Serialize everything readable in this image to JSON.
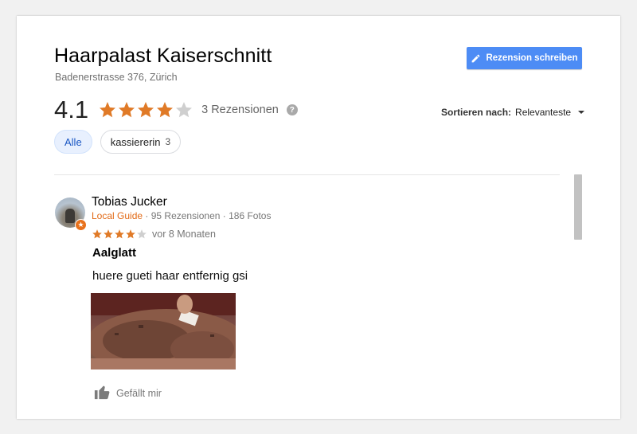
{
  "place": {
    "name": "Haarpalast Kaiserschnitt",
    "address": "Badenerstrasse 376, Zürich"
  },
  "write_review": {
    "label": "Rezension schreiben"
  },
  "summary": {
    "rating": "4.1",
    "rating_value": 4.1,
    "max_stars": 5,
    "count_text": "3 Rezensionen",
    "help_symbol": "?"
  },
  "sort": {
    "label": "Sortieren nach:",
    "value": "Relevanteste"
  },
  "filters": [
    {
      "label": "Alle",
      "count": ""
    },
    {
      "label": "kassiererin",
      "count": "3"
    }
  ],
  "colors": {
    "star_filled": "#e07a27",
    "star_empty": "#cfcfcf",
    "button_bg": "#4d8cf5",
    "local_guide": "#e26a16"
  },
  "review": {
    "author": "Tobias Jucker",
    "local_guide": "Local Guide",
    "stats": "· 95 Rezensionen · 186 Fotos",
    "stars": 4,
    "time": "vor 8 Monaten",
    "title": "Aalglatt",
    "text": "huere gueti haar entfernig gsi",
    "like_label": "Gefällt mir"
  },
  "icons": {
    "edit": "pencil-icon",
    "help": "help-icon",
    "caret": "caret-down-icon",
    "like": "thumbs-up-icon",
    "badge": "local-guide-star-icon"
  }
}
